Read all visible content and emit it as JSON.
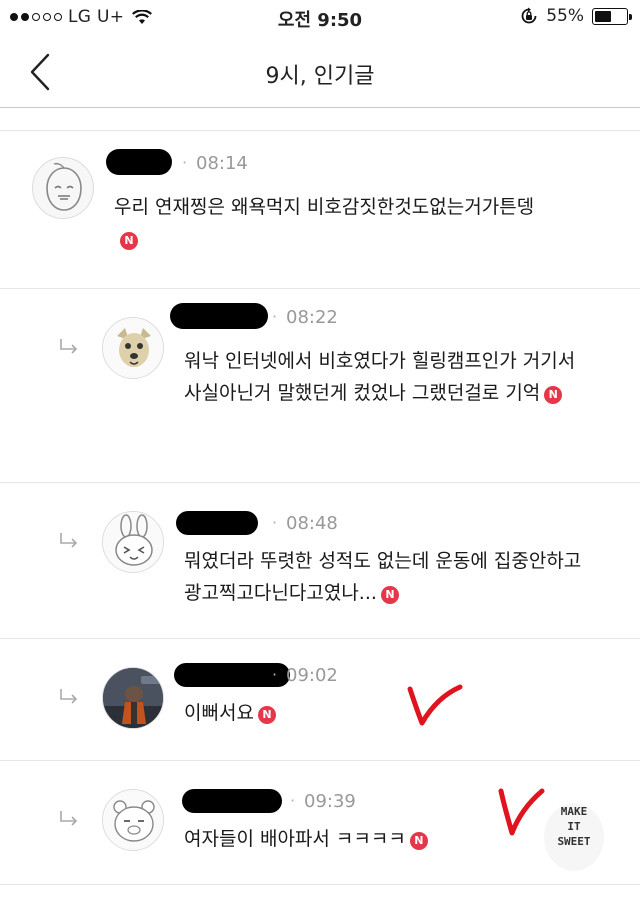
{
  "status_bar": {
    "carrier": "LG U+",
    "time": "오전 9:50",
    "battery": "55%",
    "battery_level": 0.55,
    "signal_bars_filled": 2,
    "signal_bars_total": 5
  },
  "nav": {
    "title": "9시, 인기글",
    "back_icon": "chevron-left-icon"
  },
  "colors": {
    "new_badge": "#e6374a",
    "annotation_red": "#e0141e",
    "time_gray": "#999999"
  },
  "comments": [
    {
      "time": "08:14",
      "text": "우리 연재찡은 왜욕먹지 비호감짓한것도없는거가튼뎅",
      "badge": "N",
      "is_reply": false,
      "avatar_icon": "peach-character-icon"
    },
    {
      "time": "08:22",
      "text": "워낙 인터넷에서 비호였다가 힐링캠프인가 거기서 사실아닌거 말했던게 컸었나 그랬던걸로 기억",
      "badge": "N",
      "is_reply": true,
      "avatar_icon": "dog-character-icon"
    },
    {
      "time": "08:48",
      "text": "뭐였더라 뚜렷한 성적도 없는데 운동에 집중안하고 광고찍고다닌다고였나...",
      "badge": "N",
      "is_reply": true,
      "avatar_icon": "rabbit-character-icon"
    },
    {
      "time": "09:02",
      "text": "이뻐서요",
      "badge": "N",
      "is_reply": true,
      "avatar_icon": "raccoon-photo-icon"
    },
    {
      "time": "09:39",
      "text": "여자들이 배아파서 ㅋㅋㅋㅋ",
      "badge": "N",
      "is_reply": true,
      "avatar_icon": "bear-character-icon"
    }
  ],
  "sticker": {
    "lines": [
      "MAKE",
      "IT",
      "SWEET"
    ]
  }
}
